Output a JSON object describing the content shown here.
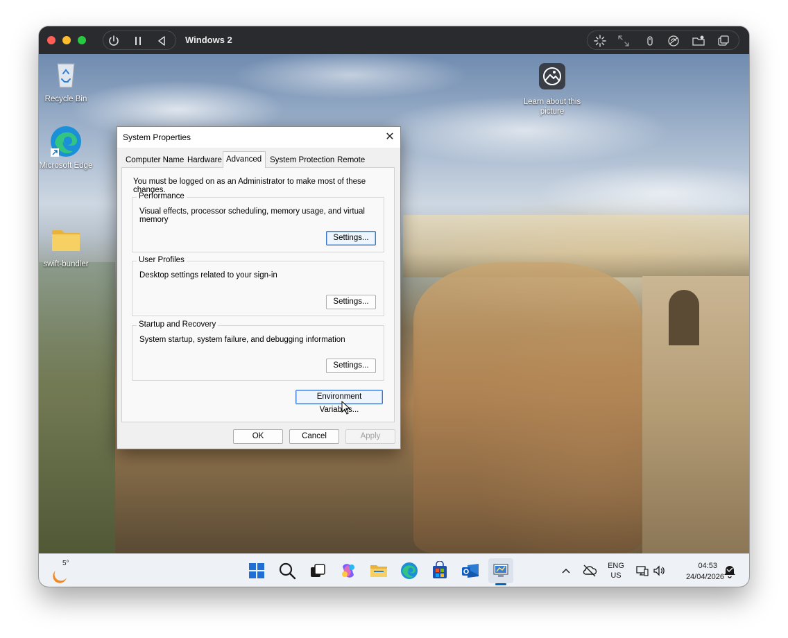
{
  "vm": {
    "title": "Windows 2",
    "controls": [
      "power-icon",
      "pause-icon",
      "back-icon"
    ],
    "right_controls": [
      "cursor-icon",
      "resize-icon",
      "usb-icon",
      "network-icon",
      "shared-folder-icon",
      "window-icon"
    ]
  },
  "desktop": {
    "icons": [
      {
        "label": "Recycle Bin"
      },
      {
        "label": "Microsoft Edge"
      },
      {
        "label": "swift-bundler"
      },
      {
        "label": "Learn about this picture"
      }
    ]
  },
  "dialog": {
    "title": "System Properties",
    "close_symbol": "✕",
    "tabs": [
      "Computer Name",
      "Hardware",
      "Advanced",
      "System Protection",
      "Remote"
    ],
    "active_tab": "Advanced",
    "admin_note": "You must be logged on as an Administrator to make most of these changes.",
    "groups": [
      {
        "label": "Performance",
        "description": "Visual effects, processor scheduling, memory usage, and virtual memory",
        "button": "Settings..."
      },
      {
        "label": "User Profiles",
        "description": "Desktop settings related to your sign-in",
        "button": "Settings..."
      },
      {
        "label": "Startup and Recovery",
        "description": "System startup, system failure, and debugging information",
        "button": "Settings..."
      }
    ],
    "env_button": "Environment Variables...",
    "ok": "OK",
    "cancel": "Cancel",
    "apply": "Apply"
  },
  "taskbar": {
    "weather_temp": "5°",
    "apps": [
      "windows-start-icon",
      "search-icon",
      "task-view-icon",
      "copilot-icon",
      "file-explorer-icon",
      "edge-icon",
      "store-icon",
      "outlook-icon",
      "system-properties-icon"
    ],
    "tray": {
      "lang_top": "ENG",
      "lang_bottom": "US",
      "time": "04:53",
      "date": "24/04/2026"
    }
  },
  "colors": {
    "accent": "#0067c0",
    "dialog_bg": "#f0f0f0",
    "taskbar_bg": "#eef1f5"
  }
}
